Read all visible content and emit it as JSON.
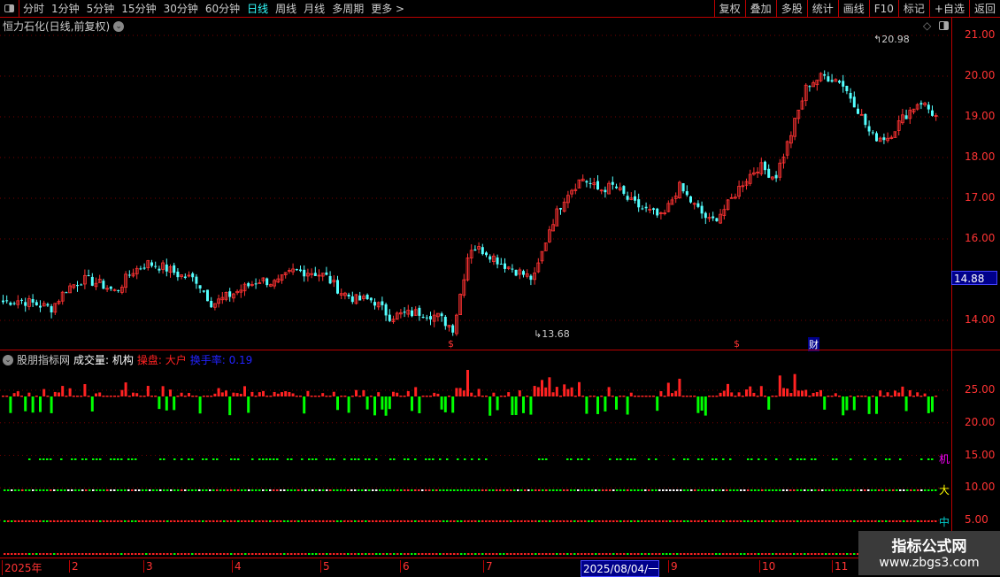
{
  "toolbar": {
    "periods": [
      "分时",
      "1分钟",
      "5分钟",
      "15分钟",
      "30分钟",
      "60分钟",
      "日线",
      "周线",
      "月线",
      "多周期",
      "更多 >"
    ],
    "active": "日线",
    "actions": [
      "复权",
      "叠加",
      "多股",
      "统计",
      "画线",
      "F10",
      "标记",
      "+自选",
      "返回"
    ]
  },
  "title": "恒力石化(日线,前复权)",
  "price_axis": [
    "21.00",
    "20.00",
    "19.00",
    "18.00",
    "17.00",
    "16.00",
    "14.00"
  ],
  "price_axis_values": [
    21,
    20,
    19,
    18,
    17,
    16,
    14
  ],
  "current_price": "14.88",
  "max_label": "20.98",
  "min_label": "13.68",
  "markers": {
    "dollar": "$",
    "finance": "财"
  },
  "indicator": {
    "name": "股朋指标网",
    "vol": "成交量: 机构",
    "op": "操盘: 大户",
    "turnover": "换手率: 0.19",
    "axis": [
      "25.00",
      "20.00",
      "15.00",
      "10.00",
      "5.00"
    ],
    "axis_values": [
      25,
      20,
      15,
      10,
      5
    ],
    "line_labels": {
      "ji": "机",
      "da": "大",
      "zhong": "中"
    }
  },
  "x_axis": [
    "2025年",
    "2",
    "3",
    "4",
    "5",
    "6",
    "7",
    "2025/08/04/一",
    "9",
    "10",
    "11"
  ],
  "watermark": {
    "title": "指标公式网",
    "url": "www.zbgs3.com"
  },
  "colors": {
    "up": "#ff3333",
    "down": "#54ffff",
    "vol_down": "#00ff00",
    "axis": "#bb0000"
  },
  "closes": [
    14.45,
    14.5,
    14.4,
    14.3,
    14.8,
    15.0,
    14.9,
    14.7,
    15.2,
    15.4,
    15.3,
    15.1,
    15.0,
    14.4,
    14.6,
    14.8,
    15.0,
    14.9,
    15.2,
    15.2,
    15.1,
    14.7,
    14.5,
    14.5,
    14.1,
    14.15,
    14.2,
    14.1,
    13.8,
    15.8,
    15.7,
    15.4,
    15.2,
    15.0,
    16.3,
    17.1,
    17.5,
    17.2,
    17.3,
    16.9,
    16.7,
    16.5,
    17.3,
    16.8,
    16.4,
    16.8,
    17.4,
    17.8,
    17.5,
    18.6,
    19.8,
    20.0,
    19.9,
    19.3,
    18.5,
    18.5,
    19.0,
    19.4,
    19.0
  ]
}
